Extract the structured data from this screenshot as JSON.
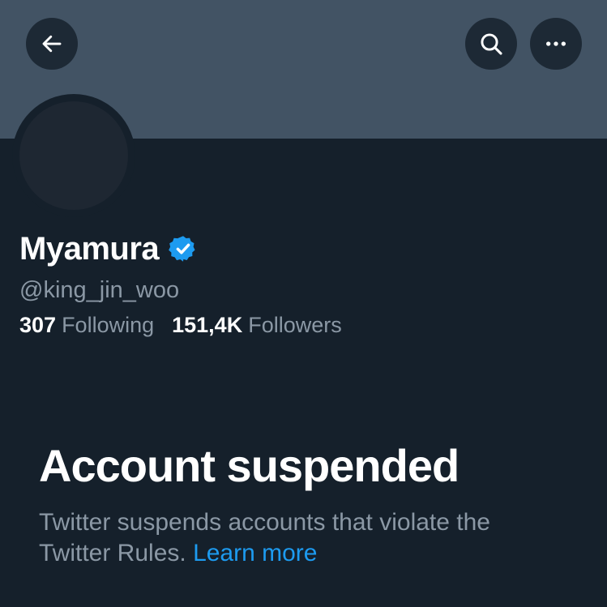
{
  "header": {
    "back_icon": "arrow-left-icon",
    "search_icon": "search-icon",
    "more_icon": "more-horizontal-icon"
  },
  "profile": {
    "display_name": "Myamura",
    "verified_icon": "verified-badge-icon",
    "handle": "@king_jin_woo",
    "following_count": "307",
    "following_label": "Following",
    "followers_count": "151,4K",
    "followers_label": "Followers"
  },
  "suspension": {
    "title": "Account suspended",
    "description": "Twitter suspends accounts that violate the Twitter Rules.",
    "learn_more": "Learn more"
  },
  "colors": {
    "background": "#15202b",
    "banner": "#425364",
    "accent": "#1d9bf0",
    "muted_text": "#8b98a5"
  }
}
